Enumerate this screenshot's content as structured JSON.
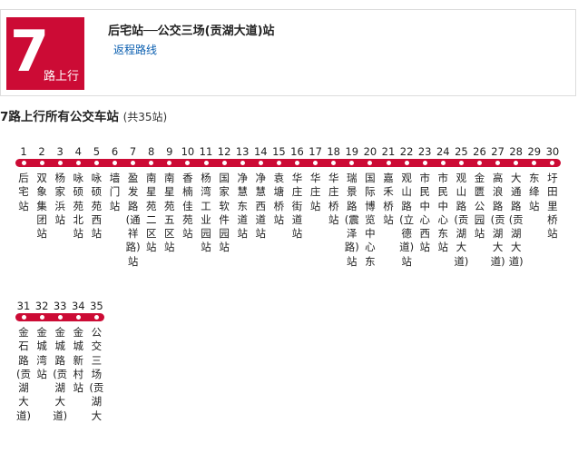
{
  "header": {
    "route_number": "7",
    "direction": "路上行",
    "title": "后宅站──公交三场(贡湖大道)站",
    "return_link": "返程路线"
  },
  "section": {
    "title": "7路上行所有公交车站",
    "count": "(共35站)"
  },
  "colors": {
    "accent": "#cc0b35",
    "link": "#0b5fb0"
  },
  "stops": [
    {
      "num": "1",
      "name": "后宅站"
    },
    {
      "num": "2",
      "name": "双象集团站"
    },
    {
      "num": "3",
      "name": "杨家浜站"
    },
    {
      "num": "4",
      "name": "咏硕苑北站"
    },
    {
      "num": "5",
      "name": "咏硕苑西站"
    },
    {
      "num": "6",
      "name": "墙门站"
    },
    {
      "num": "7",
      "name": "盈发路(通祥路)站"
    },
    {
      "num": "8",
      "name": "南星苑二区站"
    },
    {
      "num": "9",
      "name": "南星苑五区站"
    },
    {
      "num": "10",
      "name": "香楠佳苑站"
    },
    {
      "num": "11",
      "name": "杨湾工业园站"
    },
    {
      "num": "12",
      "name": "国家软件园站"
    },
    {
      "num": "13",
      "name": "净慧东道站"
    },
    {
      "num": "14",
      "name": "净慧西道站"
    },
    {
      "num": "15",
      "name": "袁塘桥站"
    },
    {
      "num": "16",
      "name": "华庄街道站"
    },
    {
      "num": "17",
      "name": "华庄站"
    },
    {
      "num": "18",
      "name": "华庄桥站"
    },
    {
      "num": "19",
      "name": "瑞景路(震泽路)站"
    },
    {
      "num": "20",
      "name": "国际博览中心东"
    },
    {
      "num": "21",
      "name": "嘉禾桥站"
    },
    {
      "num": "22",
      "name": "观山路(立德道)站"
    },
    {
      "num": "23",
      "name": "市民中心西站"
    },
    {
      "num": "24",
      "name": "市民中心东站"
    },
    {
      "num": "25",
      "name": "观山路(贡湖大道)"
    },
    {
      "num": "26",
      "name": "金匮公园站"
    },
    {
      "num": "27",
      "name": "高浪路(贡湖大道)"
    },
    {
      "num": "28",
      "name": "大通路(贡湖大道)"
    },
    {
      "num": "29",
      "name": "东绛站"
    },
    {
      "num": "30",
      "name": "圩田里桥站"
    },
    {
      "num": "31",
      "name": "金石路(贡湖大道)"
    },
    {
      "num": "32",
      "name": "金城湾站"
    },
    {
      "num": "33",
      "name": "金城路(贡湖大道)"
    },
    {
      "num": "34",
      "name": "金城新村站"
    },
    {
      "num": "35",
      "name": "公交三场(贡湖大"
    }
  ]
}
